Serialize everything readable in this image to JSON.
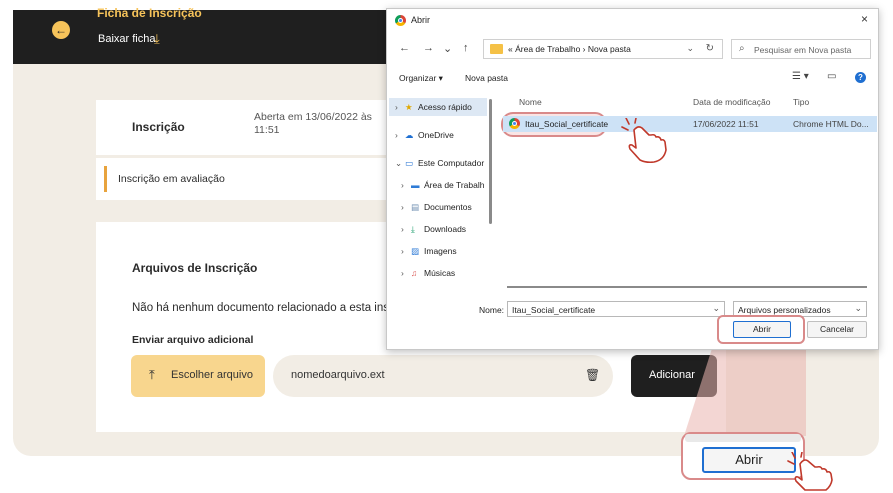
{
  "app": {
    "title": "Ficha de Inscrição",
    "back_icon": "←",
    "download_label": "Baixar ficha",
    "download_icon": "⤓",
    "inscricao_label": "Inscrição",
    "inscricao_status": "Aberta em 13/06/2022 às 11:51",
    "avaliacao_label": "Inscrição em avaliação",
    "arquivos_title": "Arquivos de Inscrição",
    "no_docs_text": "Não há nenhum documento relacionado a esta ins",
    "enviar_label": "Enviar arquivo adicional",
    "choose_icon": "⤒",
    "choose_label": "Escolher arquivo",
    "file_name": "nomedoarquivo.ext",
    "trash_icon": "🗑",
    "add_label": "Adicionar"
  },
  "dialog": {
    "title": "Abrir",
    "close_icon": "×",
    "nav_back": "←",
    "nav_forward": "→",
    "nav_dropdown": "⌄",
    "nav_up": "↑",
    "path": "« Área de Trabalho  ›  Nova pasta",
    "path_dropdown": "⌄",
    "refresh_icon": "↻",
    "search_icon": "⌕",
    "search_placeholder": "Pesquisar em Nova pasta",
    "organize_label": "Organizar ▾",
    "new_folder_label": "Nova pasta",
    "view_icon": "☰ ▾",
    "pane_icon": "▭",
    "help_icon": "?",
    "nav_items": [
      {
        "chev": "›",
        "icon": "★",
        "label": "Acesso rápido"
      },
      {
        "chev": "›",
        "icon": "☁",
        "label": "OneDrive"
      },
      {
        "chev": "⌄",
        "icon": "▭",
        "label": "Este Computador"
      },
      {
        "chev": "›",
        "icon": "▬",
        "label": "Área de Trabalh"
      },
      {
        "chev": "›",
        "icon": "▤",
        "label": "Documentos"
      },
      {
        "chev": "›",
        "icon": "⤓",
        "label": "Downloads"
      },
      {
        "chev": "›",
        "icon": "▨",
        "label": "Imagens"
      },
      {
        "chev": "›",
        "icon": "♫",
        "label": "Músicas"
      }
    ],
    "columns": {
      "name": "Nome",
      "date": "Data de modificação",
      "type": "Tipo"
    },
    "file": {
      "name": "Itau_Social_certificate",
      "date": "17/06/2022 11:51",
      "type": "Chrome HTML Do..."
    },
    "name_label": "Nome:",
    "name_value": "Itau_Social_certificate",
    "filter_value": "Arquivos personalizados",
    "dropdown_icon": "⌄",
    "open_label": "Abrir",
    "cancel_label": "Cancelar"
  },
  "zoom": {
    "open_label": "Abrir"
  },
  "colors": {
    "accent": "#f6c35a",
    "dark": "#1f1f1f",
    "highlight": "#d98a8a",
    "selection": "#cde2f6"
  }
}
